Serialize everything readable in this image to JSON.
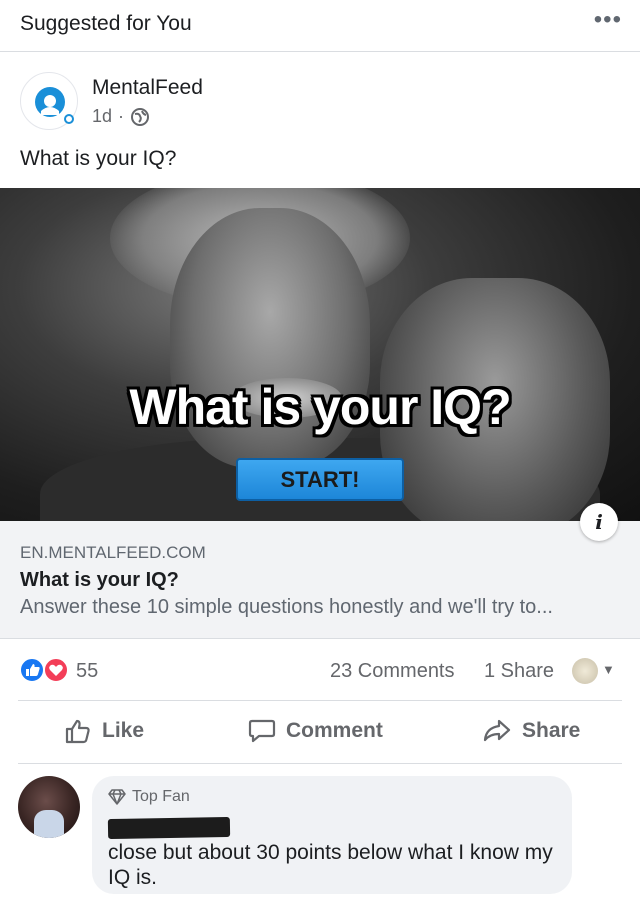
{
  "header": {
    "title": "Suggested for You",
    "more_icon": "more-horizontal-icon",
    "more_label": "•••"
  },
  "post": {
    "page_name": "MentalFeed",
    "time": "1d",
    "separator": "·",
    "privacy_icon": "globe-icon",
    "caption": "What is your IQ?",
    "image": {
      "headline": "What is your IQ?",
      "button_label": "START!"
    },
    "info_label": "i"
  },
  "link": {
    "domain": "EN.MENTALFEED.COM",
    "title": "What is your IQ?",
    "description": "Answer these 10 simple questions honestly and we'll try to..."
  },
  "stats": {
    "reaction_icons": [
      "like-reaction-icon",
      "love-reaction-icon"
    ],
    "reactions": "55",
    "comments": "23 Comments",
    "shares": "1 Share",
    "caret": "▼"
  },
  "actions": {
    "like": "Like",
    "comment": "Comment",
    "share": "Share"
  },
  "comment": {
    "badge": "Top Fan",
    "text": "close but about 30 points below what I know my IQ is."
  },
  "colors": {
    "accent": "#1877f2",
    "love": "#f33e58",
    "muted": "#65676b",
    "card_bg": "#f2f3f5"
  }
}
